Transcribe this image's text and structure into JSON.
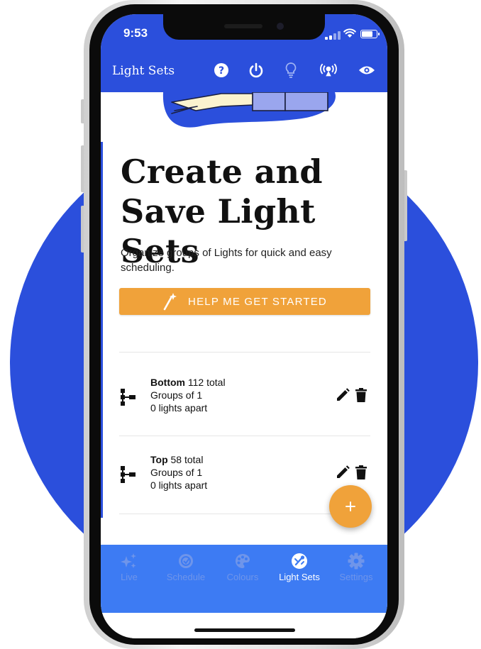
{
  "colors": {
    "brand_blue": "#2b4fdc",
    "tab_blue": "#3d7bf3",
    "accent_orange": "#f0a23a"
  },
  "status_bar": {
    "time": "9:53",
    "battery_level": 0.8
  },
  "app_bar": {
    "title": "Light Sets",
    "icons": [
      "help-icon",
      "power-icon",
      "lightbulb-icon",
      "broadcast-icon",
      "eye-icon"
    ]
  },
  "hero": {
    "headline": "Create and Save Light Sets",
    "subtitle": "Organize groups of Lights for quick and easy scheduling.",
    "help_button": "HELP ME GET STARTED"
  },
  "light_sets": [
    {
      "name": "Bottom",
      "total": "112 total",
      "groups": "Groups of 1",
      "spacing": "0 lights apart"
    },
    {
      "name": "Top",
      "total": "58 total",
      "groups": "Groups of 1",
      "spacing": "0 lights apart"
    }
  ],
  "fab": {
    "icon": "plus-icon"
  },
  "tabs": [
    {
      "label": "Live",
      "icon": "sparkle-icon",
      "active": false
    },
    {
      "label": "Schedule",
      "icon": "schedule-icon",
      "active": false
    },
    {
      "label": "Colours",
      "icon": "palette-icon",
      "active": false
    },
    {
      "label": "Light Sets",
      "icon": "light-sets-icon",
      "active": true
    },
    {
      "label": "Settings",
      "icon": "gear-icon",
      "active": false
    }
  ]
}
